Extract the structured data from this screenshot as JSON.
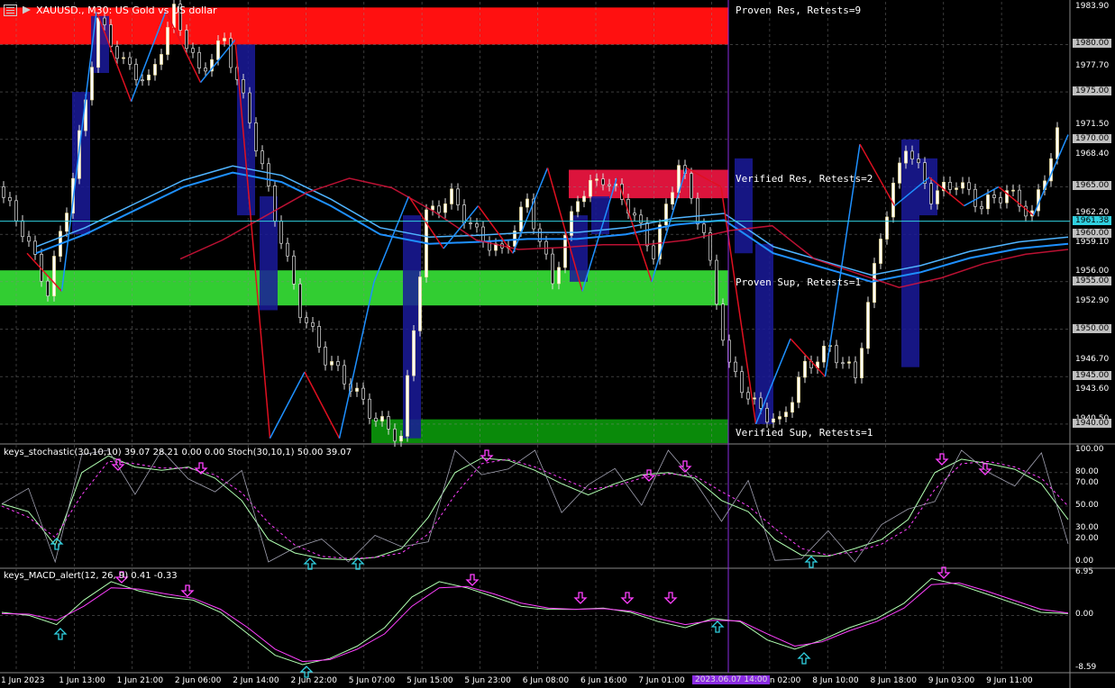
{
  "header": {
    "symbol": "XAUUSD.",
    "timeframe": "M30",
    "description": "US Gold vs US dollar",
    "title": "XAUUSD., M30: US Gold vs US dollar"
  },
  "zones": [
    {
      "label": "Proven Res, Retests=9",
      "color": "#ff1010",
      "top": 1983.9,
      "bottom": 1980.0
    },
    {
      "label": "Verified Res, Retests=2",
      "color": "#dc143c",
      "top": 1966.8,
      "bottom": 1963.8
    },
    {
      "label": "Proven Sup, Retests=1",
      "color": "#32cd32",
      "top": 1956.2,
      "bottom": 1952.5
    },
    {
      "label": "Verified Sup, Retests=1",
      "color": "#0a8a0a",
      "top": 1940.5,
      "bottom": 1938.0
    }
  ],
  "stochastic": {
    "label": "keys_stochastic(30,10,10) 39.07 28.21 0.00 0.00 Stoch(30,10,1) 50.00 39.07",
    "levels": [
      "100.00",
      "80.00",
      "70.00",
      "50.00",
      "30.00",
      "20.00",
      "0.00"
    ]
  },
  "macd": {
    "label": "keys_MACD_alert(12, 26, 9) 0.41 -0.33",
    "levels": [
      "6.95",
      "0.00",
      "-8.59"
    ]
  },
  "price_axis": {
    "labels": [
      "1983.90",
      "1980.00",
      "1977.70",
      "1975.00",
      "1971.50",
      "1970.00",
      "1968.40",
      "1965.00",
      "1962.20",
      "1960.00",
      "1959.10",
      "1956.00",
      "1955.00",
      "1952.90",
      "1950.00",
      "1946.70",
      "1945.00",
      "1943.60",
      "1940.50",
      "1940.00"
    ],
    "current_price": "1961.38"
  },
  "time_axis": {
    "labels": [
      "1 Jun 2023",
      "1 Jun 13:00",
      "1 Jun 21:00",
      "2 Jun 06:00",
      "2 Jun 14:00",
      "2 Jun 22:00",
      "5 Jun 07:00",
      "5 Jun 15:00",
      "5 Jun 23:00",
      "6 Jun 08:00",
      "6 Jun 16:00",
      "7 Jun 01:00",
      "7 Jun 17:00",
      "8 Jun 02:00",
      "8 Jun 10:00",
      "8 Jun 18:00",
      "9 Jun 03:00",
      "9 Jun 11:00"
    ],
    "crosshair": "2023.06.07 14:00"
  },
  "chart_data": {
    "type": "candlestick",
    "symbol": "XAUUSD.",
    "timeframe": "M30",
    "ylim": [
      1938.0,
      1984.5
    ],
    "x": [
      "1 Jun 2023",
      "1 Jun 13:00",
      "1 Jun 21:00",
      "2 Jun 06:00",
      "2 Jun 14:00",
      "2 Jun 22:00",
      "5 Jun 07:00",
      "5 Jun 15:00",
      "5 Jun 23:00",
      "6 Jun 08:00",
      "6 Jun 16:00",
      "7 Jun 01:00",
      "7 Jun 17:00",
      "8 Jun 02:00",
      "8 Jun 10:00",
      "8 Jun 18:00",
      "9 Jun 03:00",
      "9 Jun 11:00"
    ],
    "close_path": [
      1965.0,
      1960.5,
      1954.0,
      1966.0,
      1982.5,
      1978.0,
      1976.0,
      1983.5,
      1977.0,
      1980.5,
      1972.0,
      1962.0,
      1952.0,
      1947.0,
      1944.0,
      1940.5,
      1938.5,
      1962.0,
      1964.0,
      1960.0,
      1958.0,
      1963.5,
      1955.0,
      1964.0,
      1966.0,
      1963.0,
      1958.0,
      1967.5,
      1960.0,
      1946.0,
      1942.0,
      1940.0,
      1946.0,
      1948.0,
      1945.0,
      1960.0,
      1969.5,
      1964.0,
      1965.5,
      1963.0,
      1964.5,
      1962.0,
      1970.5
    ],
    "zigzag": [
      1958.0,
      1954.0,
      1983.5,
      1974.0,
      1983.5,
      1976.0,
      1980.5,
      1938.5,
      1945.5,
      1938.5,
      1955.0,
      1964.0,
      1958.5,
      1963.0,
      1958.0,
      1967.0,
      1954.0,
      1966.0,
      1955.0,
      1967.0,
      1965.0,
      1940.0,
      1949.0,
      1945.0,
      1969.5,
      1963.0,
      1966.0,
      1963.0,
      1965.0,
      1962.0,
      1970.5
    ],
    "ma_slow": [
      1958.0,
      1960.0,
      1962.5,
      1965.0,
      1966.5,
      1965.5,
      1963.0,
      1960.0,
      1959.0,
      1959.2,
      1959.5,
      1959.5,
      1960.0,
      1961.0,
      1961.5,
      1958.0,
      1956.5,
      1955.0,
      1956.0,
      1957.5,
      1958.5,
      1959.0
    ],
    "stochastic_levels": [
      100,
      80,
      70,
      50,
      30,
      20,
      0
    ],
    "stoch_main": [
      52,
      45,
      15,
      80,
      95,
      85,
      82,
      85,
      75,
      55,
      20,
      8,
      3,
      2,
      4,
      12,
      40,
      80,
      93,
      91,
      82,
      70,
      60,
      70,
      78,
      80,
      75,
      55,
      45,
      20,
      6,
      5,
      12,
      20,
      38,
      80,
      92,
      88,
      83,
      70,
      38
    ],
    "stoch_signal": [
      50,
      40,
      22,
      60,
      90,
      88,
      84,
      84,
      78,
      62,
      35,
      15,
      5,
      3,
      4,
      8,
      25,
      60,
      88,
      92,
      85,
      75,
      65,
      68,
      75,
      79,
      77,
      63,
      50,
      30,
      12,
      6,
      9,
      16,
      30,
      65,
      88,
      90,
      85,
      75,
      50
    ],
    "macd_levels": [
      6.95,
      0.0,
      -8.59
    ],
    "macd_main": [
      0.5,
      0.0,
      -1.5,
      2.5,
      5.5,
      4.0,
      3.0,
      2.5,
      0.5,
      -3.0,
      -6.5,
      -8.0,
      -7.0,
      -5.0,
      -2.0,
      3.0,
      5.5,
      4.5,
      3.0,
      1.5,
      1.0,
      1.0,
      1.2,
      0.5,
      -1.0,
      -2.0,
      -0.5,
      -1.0,
      -4.0,
      -5.5,
      -4.0,
      -2.0,
      -0.5,
      2.0,
      6.0,
      5.0,
      3.5,
      2.0,
      0.5,
      0.3
    ],
    "macd_signal": [
      0.3,
      0.2,
      -0.8,
      1.5,
      4.5,
      4.3,
      3.5,
      2.8,
      1.0,
      -2.0,
      -5.5,
      -7.5,
      -7.2,
      -5.5,
      -3.0,
      1.5,
      4.5,
      4.7,
      3.5,
      2.0,
      1.2,
      1.0,
      1.1,
      0.7,
      -0.5,
      -1.5,
      -0.8,
      -0.9,
      -3.0,
      -5.0,
      -4.3,
      -2.5,
      -1.0,
      1.2,
      5.0,
      5.3,
      4.0,
      2.5,
      1.0,
      0.4
    ]
  }
}
